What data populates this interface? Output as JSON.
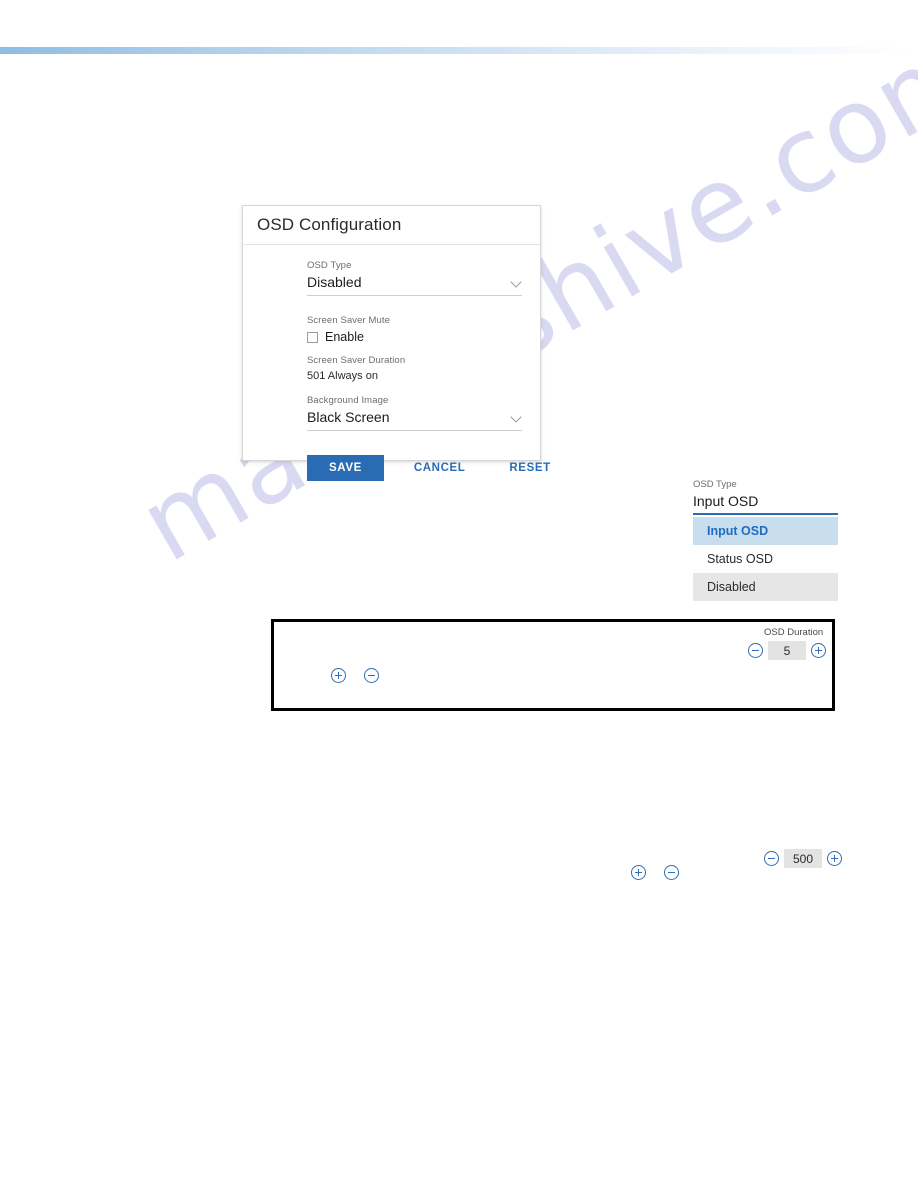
{
  "page": {
    "watermark_text": "manualshive.com",
    "accent_blue": "#2a6cb4",
    "selected_row_bg": "#c8deef",
    "hover_row_bg": "#e6e6e6"
  },
  "osd_card": {
    "title": "OSD Configuration",
    "osd_type": {
      "label": "OSD Type",
      "value": "Disabled"
    },
    "screen_saver_mute": {
      "label": "Screen Saver Mute",
      "checkbox_label": "Enable",
      "checked": false
    },
    "screen_saver_duration": {
      "label": "Screen Saver Duration",
      "value": "501 Always on"
    },
    "background_image": {
      "label": "Background Image",
      "value": "Black Screen"
    },
    "buttons": {
      "save": "SAVE",
      "cancel": "CANCEL",
      "reset": "RESET"
    }
  },
  "dropdown": {
    "label": "OSD Type",
    "current_value": "Input OSD",
    "options": [
      {
        "label": "Input OSD",
        "state": "selected"
      },
      {
        "label": "Status OSD",
        "state": "normal"
      },
      {
        "label": "Disabled",
        "state": "hover"
      }
    ]
  },
  "osd_duration_stepper": {
    "label": "OSD Duration",
    "value": "5",
    "decrement_icon": "minus-circle-icon",
    "increment_icon": "plus-circle-icon"
  },
  "bottom_stepper": {
    "value": "500",
    "decrement_icon": "minus-circle-icon",
    "increment_icon": "plus-circle-icon"
  },
  "callout_icons": {
    "plus_icon": "plus-circle-icon",
    "minus_icon": "minus-circle-icon"
  },
  "bottom_icons": {
    "plus_icon": "plus-circle-icon",
    "minus_icon": "minus-circle-icon"
  }
}
